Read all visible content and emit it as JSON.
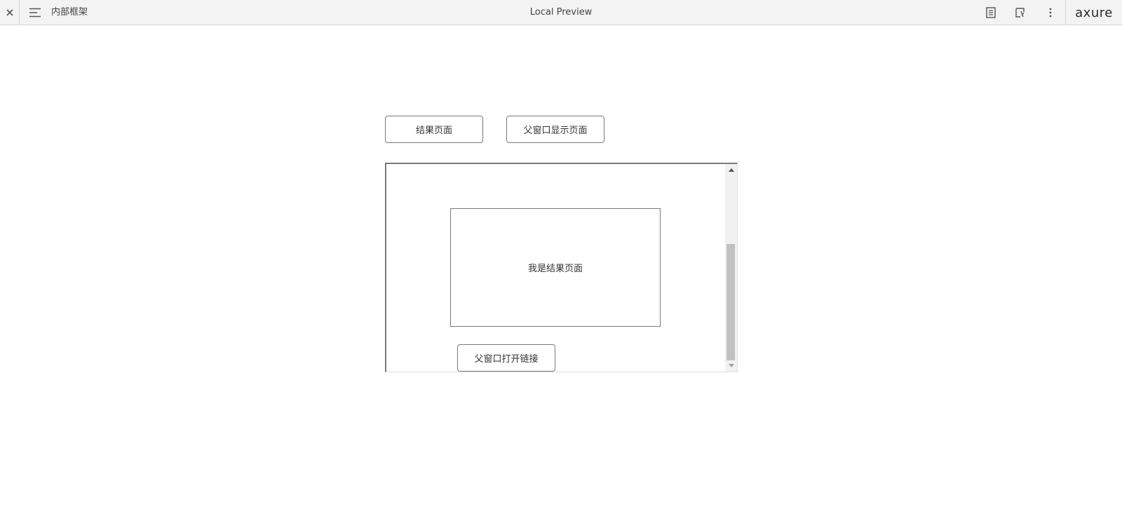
{
  "topbar": {
    "project_title": "内部框架",
    "preview_title": "Local Preview",
    "logo": "axure",
    "icons": {
      "close": "close-icon",
      "menu": "hamburger-menu-icon",
      "notes": "notes-icon",
      "interactions": "interactions-icon",
      "more": "more-vertical-icon"
    }
  },
  "canvas": {
    "buttons": {
      "result_page": "结果页面",
      "parent_window_show": "父窗口显示页面"
    },
    "inline_frame": {
      "result_box_text": "我是结果页面",
      "open_link_button": "父窗口打开链接"
    }
  },
  "colors": {
    "topbar_bg": "#f3f3f3",
    "border": "#797979",
    "scroll_thumb": "#c1c1c1"
  }
}
